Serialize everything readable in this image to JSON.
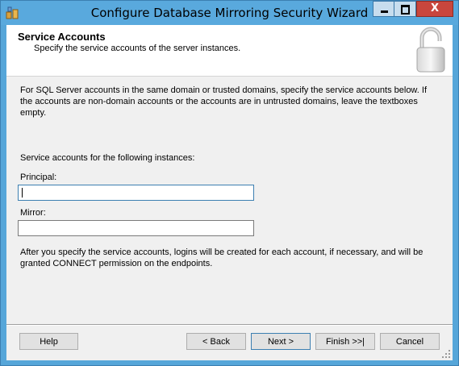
{
  "window": {
    "title": "Configure Database Mirroring Security Wizard",
    "close_glyph": "X",
    "colors": {
      "titlebar": "#59a9dd",
      "close_button": "#c9463d",
      "client_background": "#f0f0f0"
    }
  },
  "header": {
    "title": "Service Accounts",
    "subtitle": "Specify the service accounts of the server instances."
  },
  "body": {
    "intro": "For SQL Server accounts in the same domain or trusted domains, specify the service accounts below. If the accounts are non-domain accounts or the accounts are in untrusted domains, leave the textboxes empty.",
    "instances_label": "Service accounts for the following instances:",
    "principal_label": "Principal:",
    "principal_value": "",
    "mirror_label": "Mirror:",
    "mirror_value": "",
    "after_text": "After you specify the service accounts, logins will be created for each account, if necessary, and will be granted CONNECT permission on the endpoints."
  },
  "buttons": {
    "help": "Help",
    "back": "< Back",
    "next": "Next >",
    "finish": "Finish >>|",
    "cancel": "Cancel"
  },
  "icons": {
    "app": "database-wizard-icon",
    "header": "padlock-icon",
    "minimize": "minimize-icon",
    "maximize": "maximize-icon",
    "close": "close-icon",
    "resize": "resize-grip-icon"
  }
}
